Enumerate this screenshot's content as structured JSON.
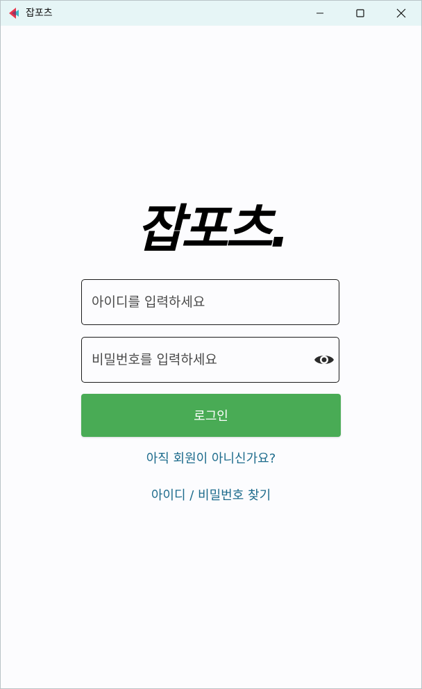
{
  "window": {
    "title": "잡포츠"
  },
  "logo": {
    "text": "잡포츠."
  },
  "login_form": {
    "id_placeholder": "아이디를 입력하세요",
    "id_value": "",
    "pw_placeholder": "비밀번호를 입력하세요",
    "pw_value": "",
    "login_label": "로그인"
  },
  "links": {
    "signup": "아직 회원이 아니신가요?",
    "find_account": "아이디 / 비밀번호 찾기"
  },
  "icons": {
    "app": "app-logo-icon",
    "minimize": "minimize-icon",
    "maximize": "maximize-icon",
    "close": "close-icon",
    "show_password": "eye-icon"
  },
  "colors": {
    "titlebar": "#e6f5f6",
    "login_button": "#49ab55",
    "link": "#1d6b8c",
    "logo_accent_red": "#e8364e",
    "logo_accent_teal": "#3fb6c4"
  }
}
